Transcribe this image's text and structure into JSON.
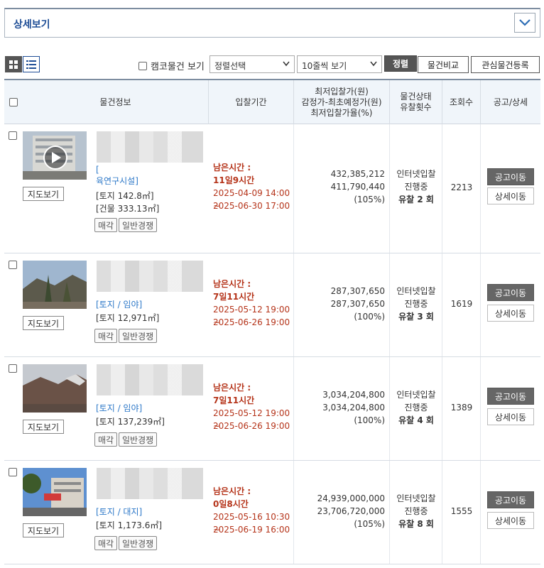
{
  "detail": {
    "title": "상세보기"
  },
  "toolbar": {
    "camco_label": "캠코물건 보기",
    "sort_select": "정렬선택",
    "rows_select": "10줄씩 보기",
    "sort_button": "정렬",
    "compare_button": "물건비교",
    "favorite_button": "관심물건등록"
  },
  "table": {
    "headers": {
      "info": "물건정보",
      "period": "입찰기간",
      "price_1": "최저입찰가(원)",
      "price_2": "감정가-최초예정가(원)",
      "price_3": "최저입찰가율(%)",
      "status_1": "물건상태",
      "status_2": "유찰횟수",
      "views": "조회수",
      "notice": "공고/상세"
    },
    "rows": [
      {
        "category": "[",
        "category_2": "육연구시설]",
        "area_land": "[토지 142.8㎡]",
        "area_building": "[건물 333.13㎡]",
        "map_button": "지도보기",
        "tag_1": "매각",
        "tag_2": "일반경쟁",
        "remain_label": "남은시간 :",
        "remain_value": "11일9시간",
        "start": "2025-04-09 14:00 ~",
        "end": "2025-06-30 17:00",
        "min_price": "432,385,212",
        "appraisal": "411,790,440",
        "rate": "(105%)",
        "status": "인터넷입찰",
        "progress": "진행중",
        "fail_count": "유찰 2 회",
        "views": "2213",
        "notice_button": "공고이동",
        "detail_button": "상세이동"
      },
      {
        "category": "[토지 / 임야]",
        "area_land": "[토지 12,971㎡]",
        "map_button": "지도보기",
        "tag_1": "매각",
        "tag_2": "일반경쟁",
        "remain_label": "남은시간 :",
        "remain_value": "7일11시간",
        "start": "2025-05-12 19:00 ~",
        "end": "2025-06-26 19:00",
        "min_price": "287,307,650",
        "appraisal": "287,307,650",
        "rate": "(100%)",
        "status": "인터넷입찰",
        "progress": "진행중",
        "fail_count": "유찰 3 회",
        "views": "1619",
        "notice_button": "공고이동",
        "detail_button": "상세이동"
      },
      {
        "category": "[토지 / 임야]",
        "area_land": "[토지 137,239㎡]",
        "map_button": "지도보기",
        "tag_1": "매각",
        "tag_2": "일반경쟁",
        "remain_label": "남은시간 :",
        "remain_value": "7일11시간",
        "start": "2025-05-12 19:00 ~",
        "end": "2025-06-26 19:00",
        "min_price": "3,034,204,800",
        "appraisal": "3,034,204,800",
        "rate": "(100%)",
        "status": "인터넷입찰",
        "progress": "진행중",
        "fail_count": "유찰 4 회",
        "views": "1389",
        "notice_button": "공고이동",
        "detail_button": "상세이동"
      },
      {
        "category": "[토지 / 대지]",
        "area_land": "[토지 1,173.6㎡]",
        "map_button": "지도보기",
        "tag_1": "매각",
        "tag_2": "일반경쟁",
        "remain_label": "남은시간 :",
        "remain_value": "0일8시간",
        "start": "2025-05-16 10:30 ~",
        "end": "2025-06-19 16:00",
        "min_price": "24,939,000,000",
        "appraisal": "23,706,720,000",
        "rate": "(105%)",
        "status": "인터넷입찰",
        "progress": "진행중",
        "fail_count": "유찰 8 회",
        "views": "1555",
        "notice_button": "공고이동",
        "detail_button": "상세이동"
      }
    ]
  }
}
